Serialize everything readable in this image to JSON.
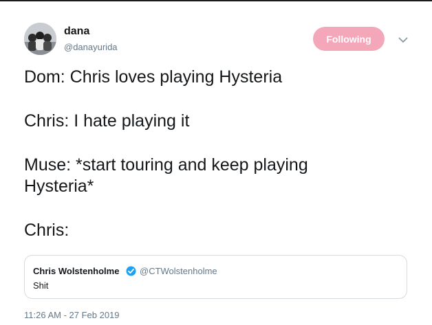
{
  "author": {
    "name": "dana",
    "handle": "@danayurida",
    "avatar_icon": "profile-photo"
  },
  "follow_button": {
    "label": "Following",
    "color": "#f4a7b9"
  },
  "menu_icon": "chevron-down-icon",
  "tweet": {
    "lines": [
      "Dom: Chris loves playing Hysteria",
      "Chris: I hate playing it",
      "Muse: *start touring and keep playing",
      "Hysteria*",
      "Chris:"
    ]
  },
  "quoted_tweet": {
    "name": "Chris Wolstenholme",
    "verified": true,
    "handle": "@CTWolstenholme",
    "text": "Shit"
  },
  "timestamp": "11:26 AM - 27 Feb 2019"
}
